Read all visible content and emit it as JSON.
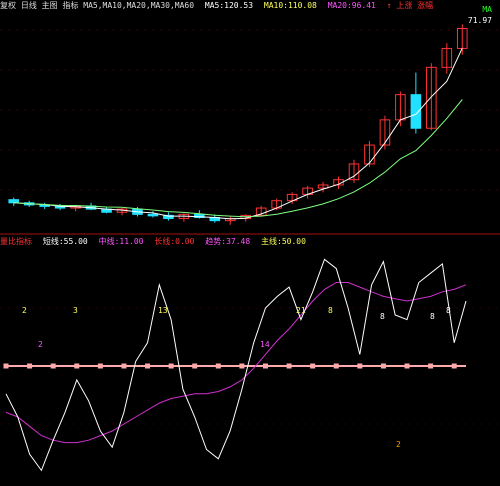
{
  "top_header": {
    "title": "复权 日线 主图 指标 MA5,MA10,MA20,MA30,MA60",
    "values": [
      "MA5:120.53",
      "MA10:110.08",
      "MA20:96.41"
    ],
    "tail": "↑ 上涨 涨幅"
  },
  "right_marks": {
    "a": "MA",
    "b": "71.97"
  },
  "lower_header": {
    "title": "量比指标",
    "items": [
      {
        "label": "短线:",
        "value": "55.00",
        "color": "#ffffff"
      },
      {
        "label": "中线:",
        "value": "11.00",
        "color": "#ff55ff"
      },
      {
        "label": "长线:",
        "value": "0.00",
        "color": "#ff3333"
      },
      {
        "label": "趋势:",
        "value": "37.48",
        "color": "#ff55ff"
      },
      {
        "label": "主线:",
        "value": "50.00",
        "color": "#ffff55"
      }
    ]
  },
  "lower_marks": [
    "2",
    "3",
    "13",
    "2",
    "14",
    "21",
    "8",
    "8",
    "8",
    "8",
    "2"
  ],
  "colors": {
    "up": "#ff3333",
    "down": "#22e0ff",
    "ma_fast": "#ffffff",
    "ma_slow": "#7fff7f",
    "divider": "#a01010",
    "line_short": "#ffffff",
    "line_mid": "#d030d0",
    "line_long": "#ffaaaa"
  },
  "chart_data": {
    "type": "candlestick",
    "candles": [
      [
        10.2,
        10.4,
        9.6,
        9.9
      ],
      [
        9.9,
        10.1,
        9.5,
        9.7
      ],
      [
        9.7,
        9.9,
        9.3,
        9.6
      ],
      [
        9.6,
        9.8,
        9.2,
        9.4
      ],
      [
        9.4,
        9.7,
        9.1,
        9.6
      ],
      [
        9.6,
        9.9,
        9.2,
        9.3
      ],
      [
        9.3,
        9.5,
        8.9,
        9.0
      ],
      [
        9.0,
        9.4,
        8.7,
        9.3
      ],
      [
        9.3,
        9.5,
        8.6,
        8.8
      ],
      [
        8.8,
        9.1,
        8.5,
        8.7
      ],
      [
        8.7,
        9.0,
        8.2,
        8.4
      ],
      [
        8.4,
        8.9,
        8.1,
        8.8
      ],
      [
        8.8,
        9.2,
        8.4,
        8.5
      ],
      [
        8.5,
        8.8,
        8.0,
        8.2
      ],
      [
        8.2,
        8.6,
        7.8,
        8.4
      ],
      [
        8.4,
        8.8,
        8.1,
        8.7
      ],
      [
        8.7,
        9.6,
        8.6,
        9.4
      ],
      [
        9.4,
        10.3,
        9.2,
        10.1
      ],
      [
        10.1,
        10.9,
        9.8,
        10.7
      ],
      [
        10.7,
        11.5,
        10.3,
        11.3
      ],
      [
        11.3,
        11.9,
        10.9,
        11.6
      ],
      [
        11.6,
        12.4,
        11.2,
        12.1
      ],
      [
        12.1,
        14.0,
        11.8,
        13.6
      ],
      [
        13.6,
        15.8,
        13.3,
        15.4
      ],
      [
        15.4,
        18.2,
        15.0,
        17.8
      ],
      [
        17.8,
        20.5,
        17.2,
        20.2
      ],
      [
        20.2,
        22.3,
        16.5,
        17.0
      ],
      [
        17.0,
        23.2,
        16.8,
        22.8
      ],
      [
        22.8,
        25.1,
        22.2,
        24.6
      ],
      [
        24.6,
        26.9,
        24.0,
        26.5
      ]
    ],
    "lines": {
      "short": [
        38,
        28,
        12,
        5,
        18,
        30,
        44,
        35,
        22,
        15,
        30,
        52,
        60,
        85,
        70,
        40,
        28,
        14,
        10,
        22,
        40,
        60,
        75,
        80,
        84,
        70,
        82,
        96,
        92,
        75,
        55,
        85,
        95,
        72,
        70,
        86,
        90,
        94,
        60,
        78
      ],
      "mid": [
        30,
        28,
        24,
        20,
        18,
        17,
        17,
        18,
        20,
        22,
        25,
        28,
        31,
        34,
        36,
        37,
        38,
        38,
        39,
        41,
        44,
        49,
        55,
        61,
        66,
        72,
        78,
        83,
        86,
        86,
        84,
        82,
        80,
        79,
        78,
        79,
        80,
        82,
        83,
        85
      ],
      "long": [
        50,
        50,
        50,
        50,
        50,
        50,
        50,
        50,
        50,
        50,
        50,
        50,
        50,
        50,
        50,
        50,
        50,
        50,
        50,
        50,
        50,
        50,
        50,
        50,
        50,
        50,
        50,
        50,
        50,
        50,
        50,
        50,
        50,
        50,
        50,
        50,
        50,
        50,
        50,
        50
      ]
    },
    "lower_ylim": [
      0,
      100
    ]
  }
}
